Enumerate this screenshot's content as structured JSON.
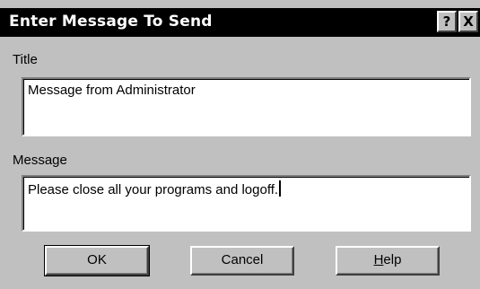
{
  "window": {
    "title": "Enter Message To Send",
    "help_glyph": "?",
    "close_glyph": "X"
  },
  "fields": {
    "title_label": "Title",
    "title_value": "Message from Administrator",
    "message_label": "Message",
    "message_value": "Please close all your programs and logoff."
  },
  "buttons": {
    "ok_label": "OK",
    "cancel_label": "Cancel",
    "help_mnemonic": "H",
    "help_rest": "elp"
  },
  "colors": {
    "dialog_face": "#c0c0c0",
    "titlebar": "#000000",
    "titlebar_text": "#ffffff",
    "field_background": "#ffffff"
  },
  "icons": {
    "help": "question-mark-icon",
    "close": "close-x-icon"
  }
}
